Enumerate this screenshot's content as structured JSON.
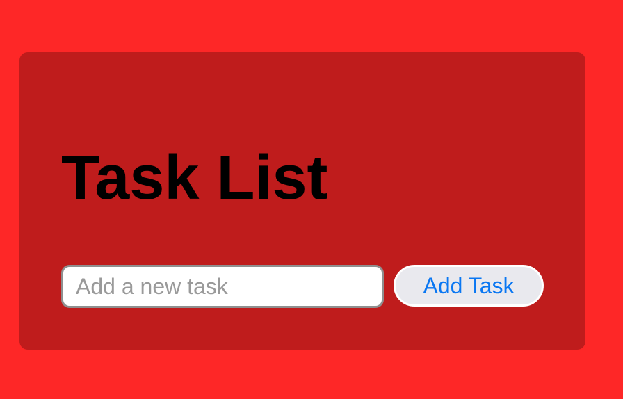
{
  "app": {
    "title": "Task List"
  },
  "task_form": {
    "input_value": "",
    "input_placeholder": "Add a new task",
    "add_button_label": "Add Task"
  },
  "colors": {
    "page_background": "#fe2727",
    "card_background": "#bf1c1c",
    "title_text": "#000000",
    "button_text": "#0a77f2",
    "button_background": "#e9e9ee",
    "input_border": "#8f8f8f"
  }
}
